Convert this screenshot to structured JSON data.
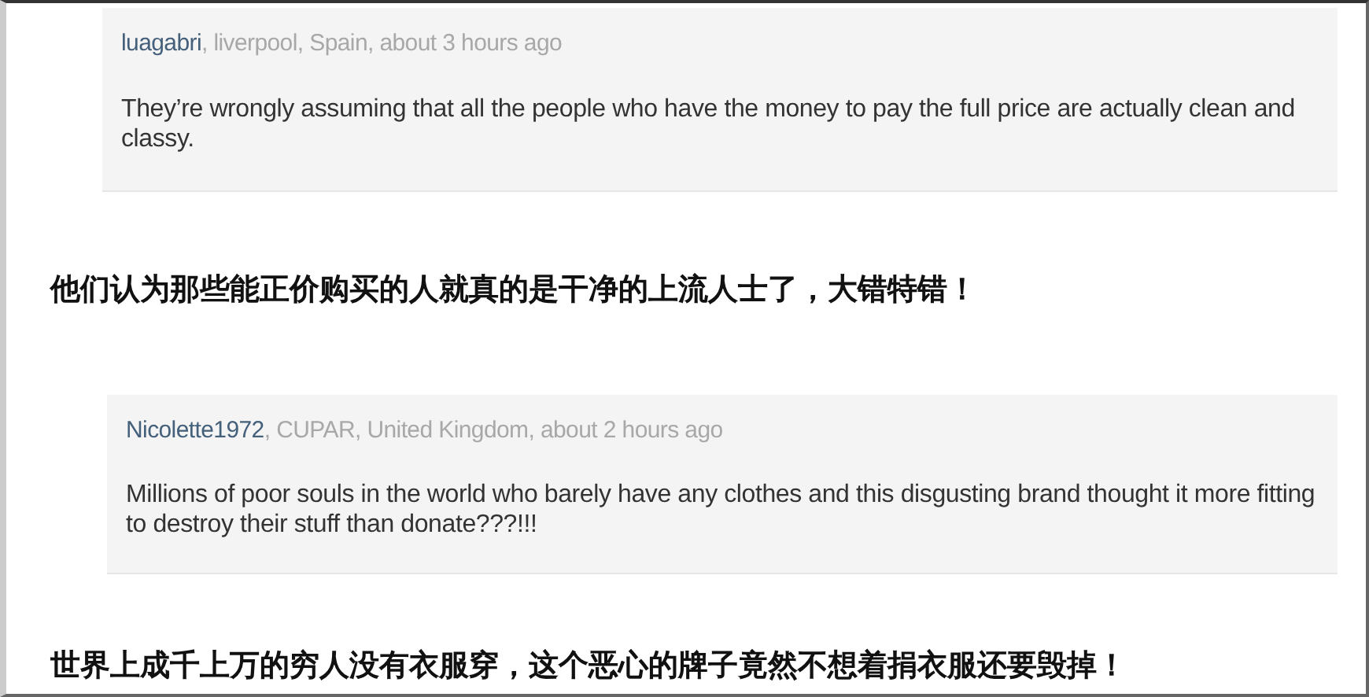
{
  "blocks": [
    {
      "kind": "comment",
      "user": "luagabri",
      "meta": ", liverpool, Spain, about 3 hours ago",
      "body": "They’re wrongly assuming that all the people who have the money to pay the full price are actually clean and classy."
    },
    {
      "kind": "caption",
      "text": "他们认为那些能正价购买的人就真的是干净的上流人士了，大错特错！"
    },
    {
      "kind": "comment",
      "user": "Nicolette1972",
      "meta": ", CUPAR, United Kingdom, about 2 hours ago",
      "body": "Millions of poor souls in the world who barely have any clothes and this disgusting brand thought it more fitting to destroy their stuff than donate???!!!"
    },
    {
      "kind": "caption",
      "text": "世界上成千上万的穷人没有衣服穿，这个恶心的牌子竟然不想着捐衣服还要毁掉！"
    }
  ]
}
